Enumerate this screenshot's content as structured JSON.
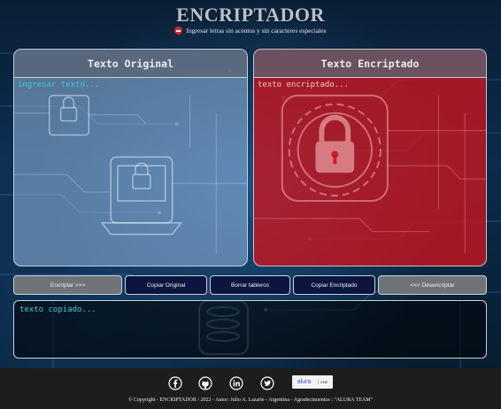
{
  "header": {
    "title": "ENCRIPTADOR",
    "subtitle": "Ingresar letras sin acentos y sin caracteres especiales",
    "subtitle_icon": "no-entry-icon"
  },
  "panels": {
    "original": {
      "title": "Texto Original",
      "placeholder": "ingresar texto...",
      "value": ""
    },
    "encrypted": {
      "title": "Texto Encriptado",
      "placeholder": "texto encriptado...",
      "value": ""
    }
  },
  "buttons": {
    "encrypt": "Encriptar >>>",
    "copy_original": "Copiar Original",
    "clear": "Borrar tableros",
    "copy_encrypted": "Copiar Encriptado",
    "decrypt": "<<< Desencriptar"
  },
  "output": {
    "placeholder": "texto copiado...",
    "value": ""
  },
  "footer": {
    "social_icons": [
      "facebook-icon",
      "github-icon",
      "linkedin-icon",
      "twitter-icon"
    ],
    "logo_brand": "alura",
    "logo_sub": "Latam",
    "logo_partner": "ONE",
    "copyright": "© Copyright - ENCRIPTADOR / 2022 - Autor: Julio A. Lazarte - Argentina - Agradecimientos : \"ALURA TEAM\""
  },
  "colors": {
    "original_panel": "#96b9e1",
    "encrypted_panel": "#cd141e",
    "button_grey": "#6f7277",
    "button_navy": "#0b1540",
    "accent_text": "#4ccad6",
    "footer_bg": "#1d1d1d"
  }
}
